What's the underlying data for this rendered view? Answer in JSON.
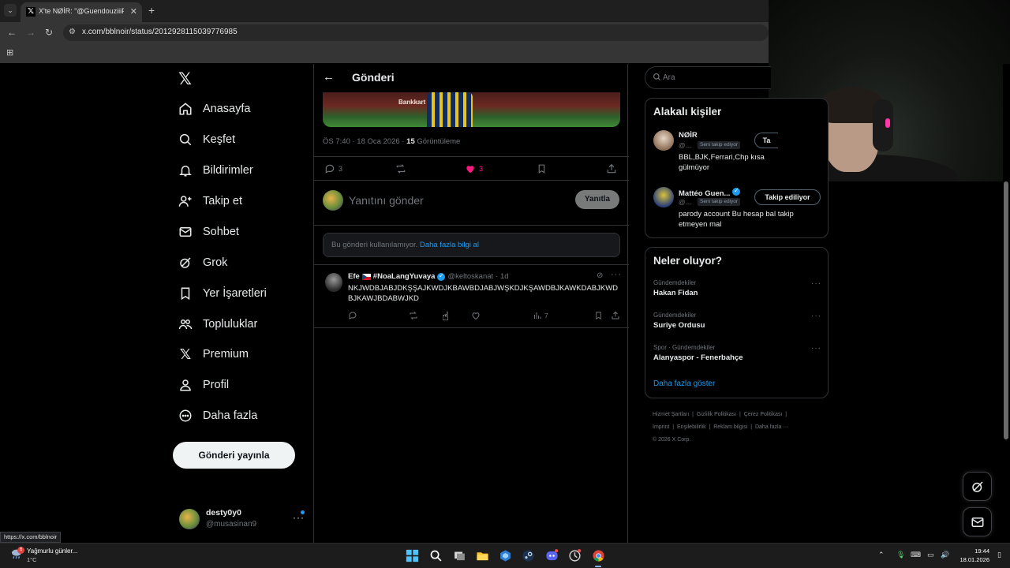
{
  "browser": {
    "tab_title": "X'te NØİR: \"@GuendouziiiFB Eli",
    "url": "x.com/bblnoir/status/2012928115039776985",
    "status_link": "https://x.com/bblnoir"
  },
  "nav": {
    "items": [
      {
        "label": "Anasayfa",
        "icon": "home-icon"
      },
      {
        "label": "Keşfet",
        "icon": "search-icon"
      },
      {
        "label": "Bildirimler",
        "icon": "bell-icon"
      },
      {
        "label": "Takip et",
        "icon": "person-add-icon"
      },
      {
        "label": "Sohbet",
        "icon": "mail-icon"
      },
      {
        "label": "Grok",
        "icon": "grok-icon"
      },
      {
        "label": "Yer İşaretleri",
        "icon": "bookmark-icon"
      },
      {
        "label": "Topluluklar",
        "icon": "communities-icon"
      },
      {
        "label": "Premium",
        "icon": "x-logo-icon"
      },
      {
        "label": "Profil",
        "icon": "profile-icon"
      },
      {
        "label": "Daha fazla",
        "icon": "more-circle-icon"
      }
    ],
    "post_button": "Gönderi yayınla",
    "account": {
      "name": "desty0y0",
      "handle": "@musasinan9"
    }
  },
  "post": {
    "header_title": "Gönderi",
    "photo_text": "Bankkart",
    "time": "ÖS 7:40 · 18 Oca 2026 · ",
    "views_count": "15",
    "views_label": " Görüntüleme",
    "replies": "3",
    "likes": "3",
    "reply_placeholder": "Yanıtını gönder",
    "reply_button": "Yanıtla",
    "unavailable_text": "Bu gönderi kullanılamıyor. ",
    "unavailable_link": "Daha fazla bilgi al"
  },
  "reply_tweet": {
    "name": "Efe",
    "tag": "#NoaLangYuvaya",
    "handle": "@keltoskanat",
    "time": "· 1d",
    "text": "NKJWDBJABJDKŞŞAJKWDJKBAWBDJABJWŞKDJKŞAWDBJKAWKDABJKWDBJKAWJBDABWJKD",
    "views": "7"
  },
  "search": {
    "placeholder": "Ara"
  },
  "relevant": {
    "title": "Alakalı kişiler",
    "people": [
      {
        "name": "NØİR",
        "handle": "@...",
        "badge": "Seni takip ediyor",
        "follow": "Ta",
        "bio": "BBL,BJK,Ferrari,Chp kısa gülmüyor"
      },
      {
        "name": "Mattéo Guen...",
        "handle": "@...",
        "badge": "Seni takip ediyor",
        "follow": "Takip ediliyor",
        "bio": "parody account Bu hesap bal takip etmeyen mal"
      }
    ]
  },
  "trends": {
    "title": "Neler oluyor?",
    "items": [
      {
        "category": "Gündemdekiler",
        "name": "Hakan Fidan"
      },
      {
        "category": "Gündemdekiler",
        "name": "Suriye Ordusu"
      },
      {
        "category": "Spor · Gündemdekiler",
        "name": "Alanyaspor - Fenerbahçe"
      }
    ],
    "show_more": "Daha fazla göster"
  },
  "footer": {
    "links": [
      "Hizmet Şartları",
      "Gizlilik Politikası",
      "Çerez Politikası",
      "Imprint",
      "Erişilebilirlik",
      "Reklam bilgisi",
      "Daha fazla ···"
    ],
    "copyright": "© 2026 X Corp."
  },
  "taskbar": {
    "weather_title": "Yağmurlu günler...",
    "weather_temp": "1°C",
    "weather_badge": "6",
    "time": "19:44",
    "date": "18.01.2026"
  },
  "colors": {
    "accent": "#1d9bf0",
    "like": "#f91880",
    "background": "#000000"
  }
}
